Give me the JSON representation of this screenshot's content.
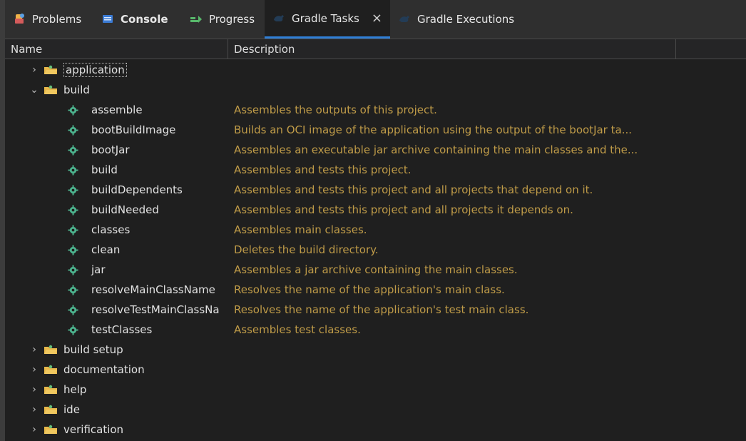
{
  "tabs": [
    {
      "label": "Problems",
      "icon": "problems-icon",
      "active": false,
      "bold": false
    },
    {
      "label": "Console",
      "icon": "console-icon",
      "active": false,
      "bold": true
    },
    {
      "label": "Progress",
      "icon": "progress-icon",
      "active": false,
      "bold": false
    },
    {
      "label": "Gradle Tasks",
      "icon": "gradle-icon",
      "active": true,
      "bold": false,
      "closable": true
    },
    {
      "label": "Gradle Executions",
      "icon": "gradle-icon",
      "active": false,
      "bold": false
    }
  ],
  "columns": {
    "name": "Name",
    "description": "Description"
  },
  "tree": {
    "groups": [
      {
        "name": "application",
        "expanded": false
      },
      {
        "name": "build",
        "expanded": true,
        "tasks": [
          {
            "name": "assemble",
            "description": "Assembles the outputs of this project."
          },
          {
            "name": "bootBuildImage",
            "description": "Builds an OCI image of the application using the output of the bootJar ta..."
          },
          {
            "name": "bootJar",
            "description": "Assembles an executable jar archive containing the main classes and the..."
          },
          {
            "name": "build",
            "description": "Assembles and tests this project."
          },
          {
            "name": "buildDependents",
            "description": "Assembles and tests this project and all projects that depend on it."
          },
          {
            "name": "buildNeeded",
            "description": "Assembles and tests this project and all projects it depends on."
          },
          {
            "name": "classes",
            "description": "Assembles main classes."
          },
          {
            "name": "clean",
            "description": "Deletes the build directory."
          },
          {
            "name": "jar",
            "description": "Assembles a jar archive containing the main classes."
          },
          {
            "name": "resolveMainClassName",
            "description": "Resolves the name of the application's main class."
          },
          {
            "name": "resolveTestMainClassNa",
            "description": "Resolves the name of the application's test main class."
          },
          {
            "name": "testClasses",
            "description": "Assembles test classes."
          }
        ]
      },
      {
        "name": "build setup",
        "expanded": false
      },
      {
        "name": "documentation",
        "expanded": false
      },
      {
        "name": "help",
        "expanded": false
      },
      {
        "name": "ide",
        "expanded": false
      },
      {
        "name": "verification",
        "expanded": false
      }
    ]
  },
  "colors": {
    "background": "#1f1f1f",
    "description": "#bf9b48",
    "tab_active_underline": "#2f7fd7",
    "gear": "#4db58f",
    "folder": "#e8b84a"
  }
}
